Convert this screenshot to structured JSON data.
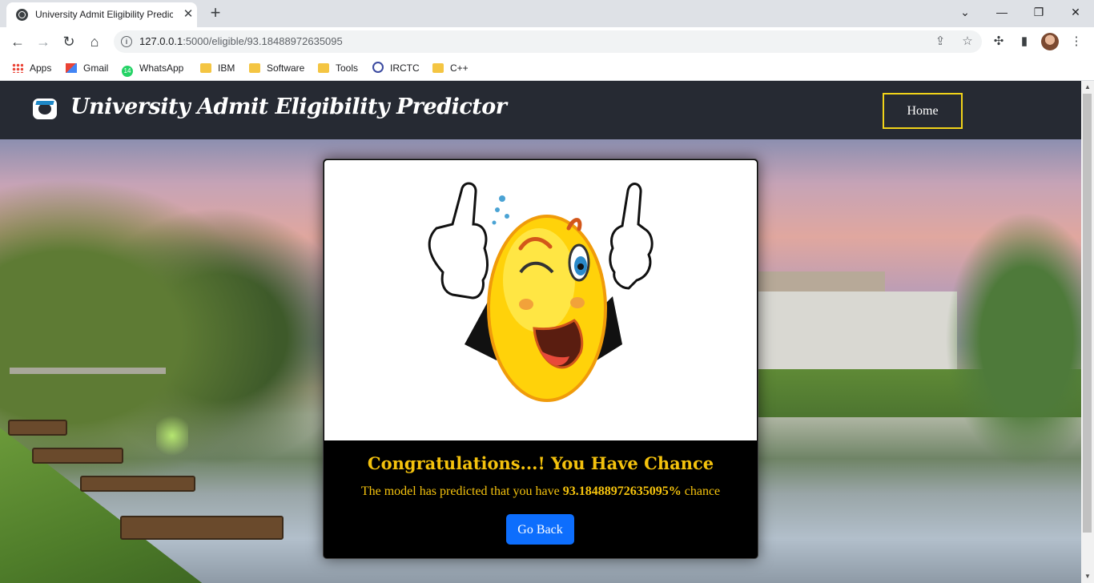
{
  "browser": {
    "tab_title": "University Admit Eligibility Predic",
    "url_host": "127.0.0.1",
    "url_path": ":5000/eligible/93.18488972635095",
    "bookmarks": [
      "Apps",
      "Gmail",
      "WhatsApp",
      "IBM",
      "Software",
      "Tools",
      "IRCTC",
      "C++"
    ],
    "whatsapp_badge": "14"
  },
  "header": {
    "title": "University Admit Eligibility Predictor",
    "home_label": "Home"
  },
  "result": {
    "heading": "Congratulations...! You Have Chance",
    "text_before": "The model has predicted that you have ",
    "percentage": "93.18488972635095%",
    "text_after": " chance",
    "go_back_label": "Go Back"
  },
  "colors": {
    "header_bg": "#262a33",
    "accent_yellow": "#f4c20d",
    "button_blue": "#0d6efd",
    "home_border": "#f1d319"
  }
}
